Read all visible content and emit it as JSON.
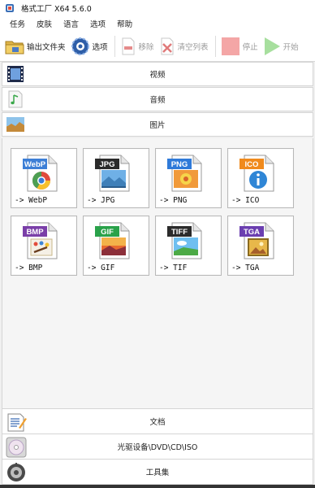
{
  "window": {
    "title": "格式工厂 X64 5.6.0"
  },
  "menu": {
    "items": [
      "任务",
      "皮肤",
      "语言",
      "选项",
      "帮助"
    ]
  },
  "toolbar": {
    "output_folder": "输出文件夹",
    "options": "选项",
    "remove": "移除",
    "clear_list": "清空列表",
    "stop": "停止",
    "start": "开始"
  },
  "categories": {
    "video": "视频",
    "audio": "音频",
    "picture": "图片",
    "document": "文档",
    "disc": "光驱设备\\DVD\\CD\\ISO",
    "tools": "工具集"
  },
  "tiles": [
    {
      "badge": "WebP",
      "label": "-> WebP",
      "badge_color": "#3d7fd6",
      "art": "chrome"
    },
    {
      "badge": "JPG",
      "label": "-> JPG",
      "badge_color": "#2b2b2b",
      "art": "landscape"
    },
    {
      "badge": "PNG",
      "label": "-> PNG",
      "badge_color": "#2f7ad9",
      "art": "flower"
    },
    {
      "badge": "ICO",
      "label": "-> ICO",
      "badge_color": "#f08a1c",
      "art": "info"
    },
    {
      "badge": "BMP",
      "label": "-> BMP",
      "badge_color": "#7a3fa8",
      "art": "paint"
    },
    {
      "badge": "GIF",
      "label": "-> GIF",
      "badge_color": "#2aa24a",
      "art": "sunset"
    },
    {
      "badge": "TIFF",
      "label": "-> TIF",
      "badge_color": "#2b2b2b",
      "art": "sky"
    },
    {
      "badge": "TGA",
      "label": "-> TGA",
      "badge_color": "#6b3fb0",
      "art": "frame"
    }
  ]
}
